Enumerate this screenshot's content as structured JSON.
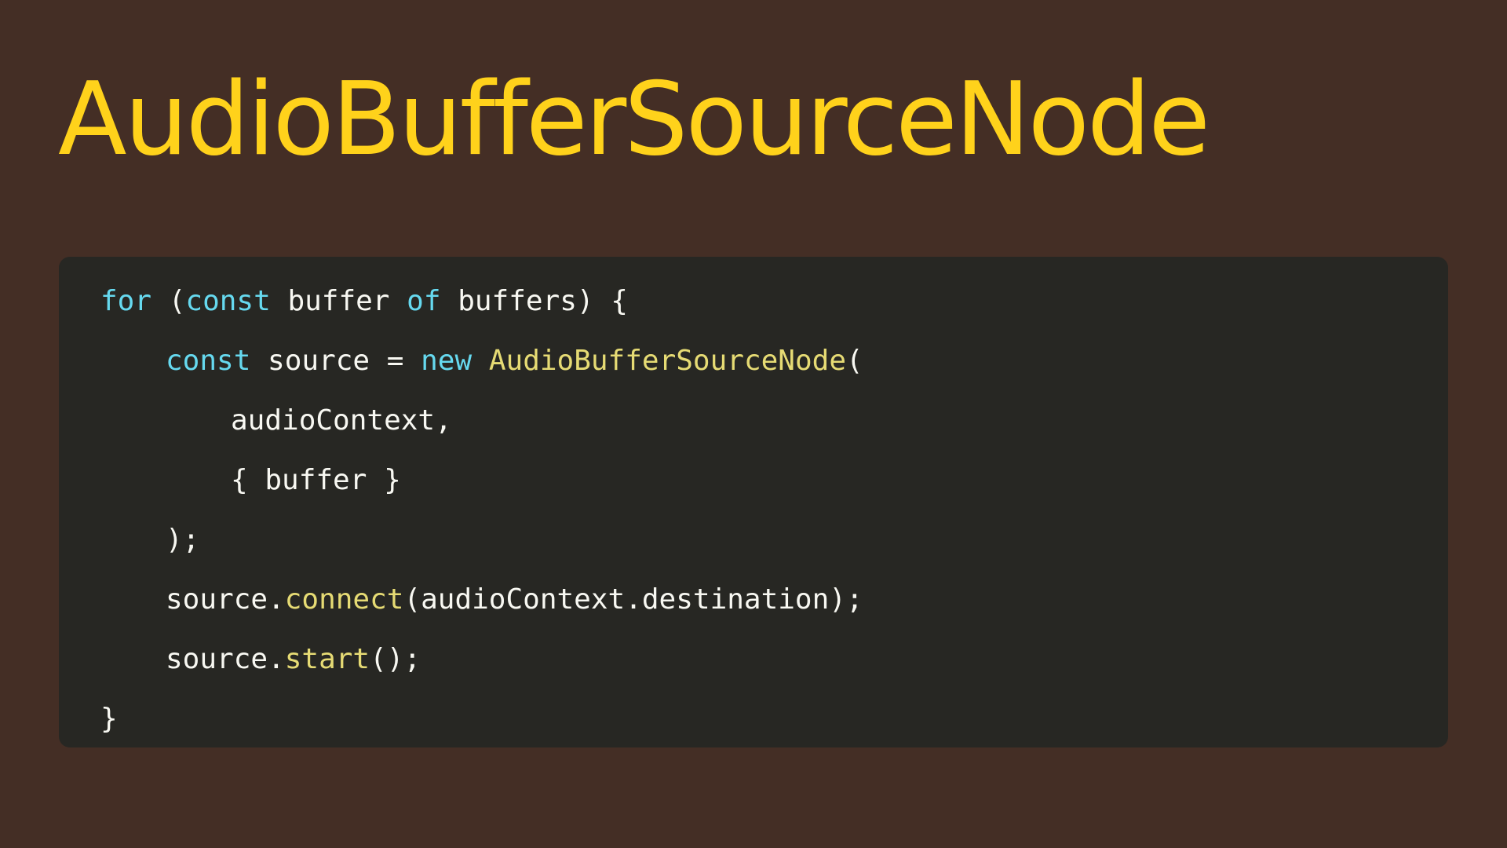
{
  "title": "AudioBufferSourceNode",
  "colors": {
    "background": "#442e25",
    "title": "#ffd21b",
    "code_background": "#272723",
    "keyword": "#66d9ef",
    "function": "#e6db74",
    "plain": "#f8f8f2"
  },
  "code": {
    "lines": [
      {
        "indent": 0,
        "tokens": [
          {
            "text": "for",
            "kind": "keyword"
          },
          {
            "text": " (",
            "kind": "plain"
          },
          {
            "text": "const",
            "kind": "keyword"
          },
          {
            "text": " buffer ",
            "kind": "plain"
          },
          {
            "text": "of",
            "kind": "keyword"
          },
          {
            "text": " buffers) {",
            "kind": "plain"
          }
        ]
      },
      {
        "indent": 1,
        "tokens": [
          {
            "text": "const",
            "kind": "keyword"
          },
          {
            "text": " source = ",
            "kind": "plain"
          },
          {
            "text": "new",
            "kind": "keyword"
          },
          {
            "text": " ",
            "kind": "plain"
          },
          {
            "text": "AudioBufferSourceNode",
            "kind": "func"
          },
          {
            "text": "(",
            "kind": "plain"
          }
        ]
      },
      {
        "indent": 2,
        "tokens": [
          {
            "text": "audioContext,",
            "kind": "plain"
          }
        ]
      },
      {
        "indent": 2,
        "tokens": [
          {
            "text": "{ buffer }",
            "kind": "plain"
          }
        ]
      },
      {
        "indent": 1,
        "tokens": [
          {
            "text": ");",
            "kind": "plain"
          }
        ]
      },
      {
        "indent": 1,
        "tokens": [
          {
            "text": "source.",
            "kind": "plain"
          },
          {
            "text": "connect",
            "kind": "func"
          },
          {
            "text": "(audioContext.destination);",
            "kind": "plain"
          }
        ]
      },
      {
        "indent": 1,
        "tokens": [
          {
            "text": "source.",
            "kind": "plain"
          },
          {
            "text": "start",
            "kind": "func"
          },
          {
            "text": "();",
            "kind": "plain"
          }
        ]
      },
      {
        "indent": 0,
        "tokens": [
          {
            "text": "}",
            "kind": "plain"
          }
        ]
      }
    ]
  }
}
